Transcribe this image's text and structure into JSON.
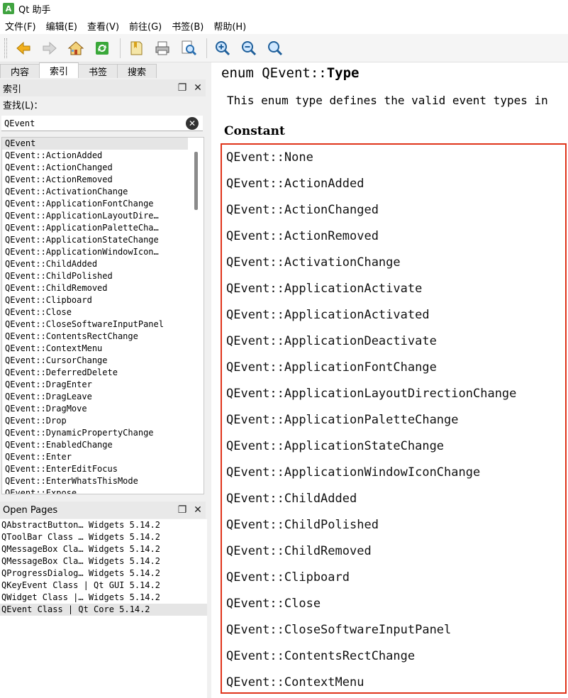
{
  "window": {
    "icon_letter": "A",
    "title": "Qt 助手"
  },
  "menubar": [
    "文件(F)",
    "编辑(E)",
    "查看(V)",
    "前往(G)",
    "书签(B)",
    "帮助(H)"
  ],
  "toolbar": {
    "buttons": [
      "back-arrow-icon",
      "forward-arrow-icon",
      "home-icon",
      "sync-contents-icon",
      "bookmark-icon",
      "print-icon",
      "find-icon",
      "zoom-in-icon",
      "zoom-out-icon",
      "reset-zoom-icon"
    ]
  },
  "tabs": [
    "内容",
    "索引",
    "书签",
    "搜索"
  ],
  "index_panel": {
    "title": "索引",
    "find_label": "查找(L)：",
    "search_value": "QEvent",
    "items": [
      "QEvent",
      "QEvent::ActionAdded",
      "QEvent::ActionChanged",
      "QEvent::ActionRemoved",
      "QEvent::ActivationChange",
      "QEvent::ApplicationFontChange",
      "QEvent::ApplicationLayoutDire…",
      "QEvent::ApplicationPaletteCha…",
      "QEvent::ApplicationStateChange",
      "QEvent::ApplicationWindowIcon…",
      "QEvent::ChildAdded",
      "QEvent::ChildPolished",
      "QEvent::ChildRemoved",
      "QEvent::Clipboard",
      "QEvent::Close",
      "QEvent::CloseSoftwareInputPanel",
      "QEvent::ContentsRectChange",
      "QEvent::ContextMenu",
      "QEvent::CursorChange",
      "QEvent::DeferredDelete",
      "QEvent::DragEnter",
      "QEvent::DragLeave",
      "QEvent::DragMove",
      "QEvent::Drop",
      "QEvent::DynamicPropertyChange",
      "QEvent::EnabledChange",
      "QEvent::Enter",
      "QEvent::EnterEditFocus",
      "QEvent::EnterWhatsThisMode",
      "QEvent::Expose"
    ]
  },
  "open_pages": {
    "title": "Open Pages",
    "items": [
      "QAbstractButton… Widgets 5.14.2",
      "QToolBar Class … Widgets 5.14.2",
      "QMessageBox Cla… Widgets 5.14.2",
      "QMessageBox Cla… Widgets 5.14.2",
      "QProgressDialog… Widgets 5.14.2",
      "QKeyEvent Class | Qt GUI 5.14.2",
      "QWidget Class |… Widgets 5.14.2",
      "QEvent Class | Qt Core 5.14.2"
    ]
  },
  "content": {
    "title_prefix": "enum QEvent::",
    "title_bold": "Type",
    "description": "This enum type defines the valid event types in",
    "column_header": "Constant",
    "constants": [
      "QEvent::None",
      "QEvent::ActionAdded",
      "QEvent::ActionChanged",
      "QEvent::ActionRemoved",
      "QEvent::ActivationChange",
      "QEvent::ApplicationActivate",
      "QEvent::ApplicationActivated",
      "QEvent::ApplicationDeactivate",
      "QEvent::ApplicationFontChange",
      "QEvent::ApplicationLayoutDirectionChange",
      "QEvent::ApplicationPaletteChange",
      "QEvent::ApplicationStateChange",
      "QEvent::ApplicationWindowIconChange",
      "QEvent::ChildAdded",
      "QEvent::ChildPolished",
      "QEvent::ChildRemoved",
      "QEvent::Clipboard",
      "QEvent::Close",
      "QEvent::CloseSoftwareInputPanel",
      "QEvent::ContentsRectChange",
      "QEvent::ContextMenu"
    ]
  },
  "colors": {
    "highlight_border": "#e0341a",
    "selection_bg": "#e5e5e5"
  }
}
